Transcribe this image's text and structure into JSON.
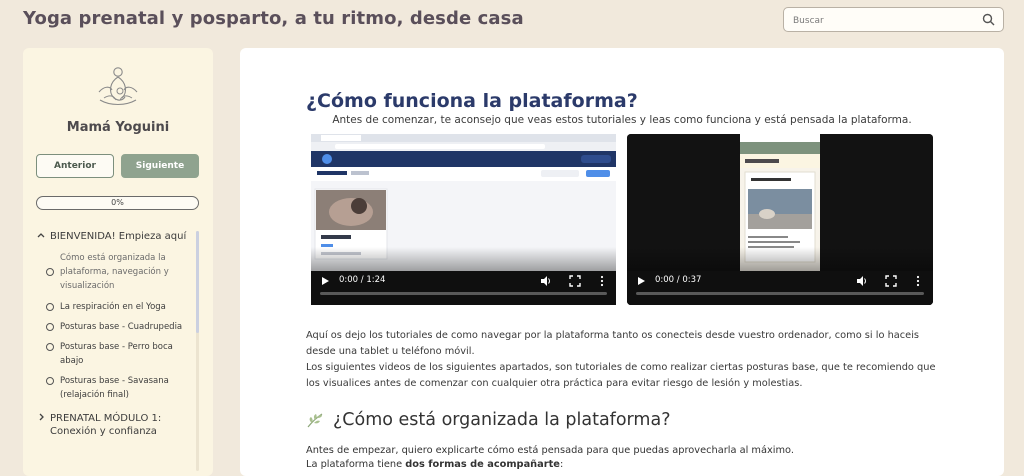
{
  "header": {
    "site_title": "Yoga prenatal y posparto, a tu ritmo, desde casa",
    "search_placeholder": "Buscar"
  },
  "sidebar": {
    "course_name": "Mamá Yoguini",
    "prev_label": "Anterior",
    "next_label": "Siguiente",
    "progress_text": "0%",
    "progress_fraction": 0,
    "modules": [
      {
        "title": "BIENVENIDA! Empieza aquí",
        "lessons": [
          "Cómo está organizada la plataforma, navegación y visualización",
          "La respiración en el Yoga",
          "Posturas base - Cuadrupedia",
          "Posturas base - Perro boca abajo",
          "Posturas base - Savasana (relajación final)"
        ]
      },
      {
        "title": "PRENATAL MÓDULO 1: Conexión y confianza"
      }
    ]
  },
  "main": {
    "title": "¿Cómo funciona la plataforma?",
    "intro": "Antes de comenzar, te aconsejo que veas estos tutoriales y leas como funciona y está pensada la plataforma.",
    "videos": [
      {
        "time": "0:00 / 1:24",
        "played_fraction": 0
      },
      {
        "time": "0:00 / 0:37",
        "played_fraction": 0
      }
    ],
    "para1": "Aquí os dejo los tutoriales de como navegar por la plataforma tanto os conecteis desde vuestro ordenador, como si lo haceis desde una tablet u teléfono móvil.",
    "para2": "Los siguientes videos de los siguientes apartados, son tutoriales de como realizar ciertas posturas base, que te recomiendo que los visualices antes de comenzar con cualquier otra práctica para evitar riesgo de lesión y molestias.",
    "section_title": "¿Cómo está organizada la plataforma?",
    "section_p1": "Antes de empezar, quiero explicarte cómo está pensada para que puedas aprovecharla al máximo.",
    "section_p2_prefix": "La plataforma tiene ",
    "section_p2_bold": "dos formas de acompañarte",
    "section_p2_suffix": ":"
  },
  "colors": {
    "background": "#f1e9dc",
    "sidebar": "#fbf5e2",
    "accent_green": "#8fa38f",
    "heading_blue": "#2b3a6a"
  }
}
